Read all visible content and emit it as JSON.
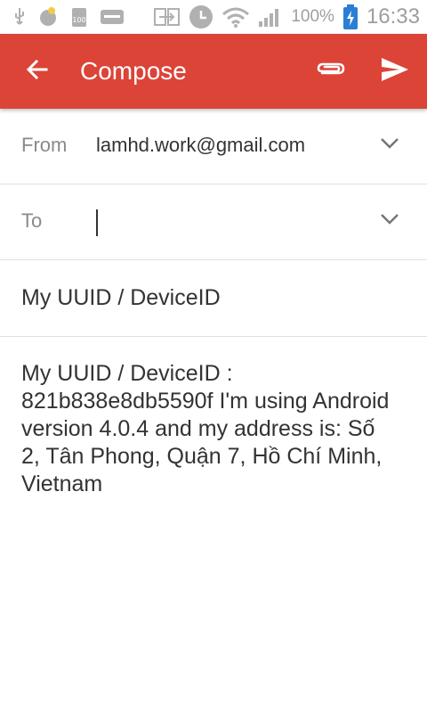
{
  "status_bar": {
    "battery_percent": "100%",
    "time": "16:33",
    "icons": [
      "usb-icon",
      "notification-icon",
      "battery-saver-icon",
      "keyboard-icon",
      "screen-mirror-icon",
      "alarm-icon",
      "wifi-icon",
      "signal-icon",
      "battery-icon"
    ],
    "mini_badge": "100"
  },
  "app_bar": {
    "title": "Compose",
    "background_color": "#db4437"
  },
  "from": {
    "label": "From",
    "value": "lamhd.work@gmail.com"
  },
  "to": {
    "label": "To",
    "value": ""
  },
  "subject": {
    "value": "My UUID / DeviceID"
  },
  "body": {
    "text": "My UUID / DeviceID : 821b838e8db5590f I'm using Android version 4.0.4 and my address is: Số 2, Tân Phong, Quận 7, Hồ Chí Minh, Vietnam"
  }
}
